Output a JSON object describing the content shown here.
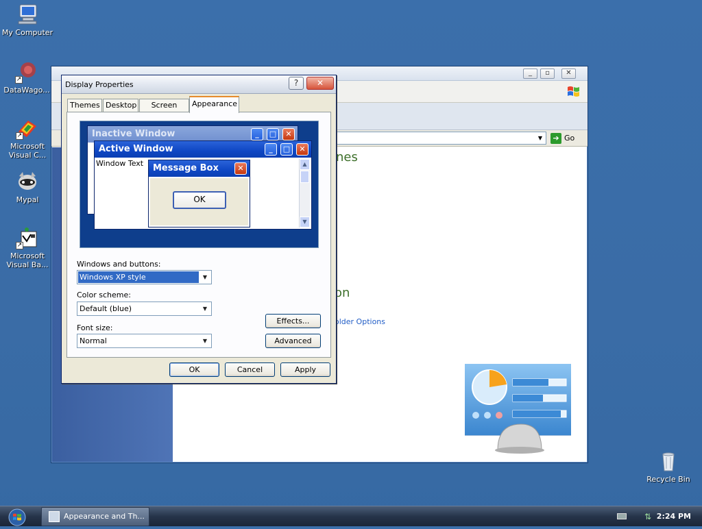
{
  "desktop": {
    "icons": [
      {
        "label": "My Computer",
        "icon": "my-computer-icon"
      },
      {
        "label": "DataWago...",
        "icon": "datawago-icon"
      },
      {
        "label": "Microsoft Visual C...",
        "icon": "visual-c-icon"
      },
      {
        "label": "Mypal",
        "icon": "mypal-icon"
      },
      {
        "label": "Microsoft Visual Ba...",
        "icon": "visual-basic-icon"
      },
      {
        "label": "Recycle Bin",
        "icon": "recycle-bin-icon"
      }
    ]
  },
  "explorer": {
    "go_label": "Go",
    "content_heading_1": "nes",
    "content_heading_2": "on",
    "content_link": "older Options"
  },
  "dialog": {
    "title": "Display Properties",
    "help_glyph": "?",
    "close_glyph": "✕",
    "tabs": [
      {
        "label": "Themes",
        "active": false
      },
      {
        "label": "Desktop",
        "active": false
      },
      {
        "label": "Screen Saver",
        "active": false
      },
      {
        "label": "Appearance",
        "active": true
      }
    ],
    "preview": {
      "inactive_title": "Inactive Window",
      "active_title": "Active Window",
      "window_text": "Window Text",
      "message_title": "Message Box",
      "message_ok": "OK"
    },
    "windows_buttons_label": "Windows and buttons:",
    "windows_buttons_value": "Windows XP style",
    "color_scheme_label": "Color scheme:",
    "color_scheme_value": "Default (blue)",
    "font_size_label": "Font size:",
    "font_size_value": "Normal",
    "effects_label": "Effects...",
    "advanced_label": "Advanced",
    "ok_label": "OK",
    "cancel_label": "Cancel",
    "apply_label": "Apply"
  },
  "taskbar": {
    "task_label": "Appearance and Th...",
    "clock": "2:24 PM"
  },
  "colors": {
    "desktop": "#3a6ea5",
    "dialog_face": "#ece9d8",
    "title_blue": "#0f47c4",
    "preview_bg": "#0e3e8c"
  }
}
